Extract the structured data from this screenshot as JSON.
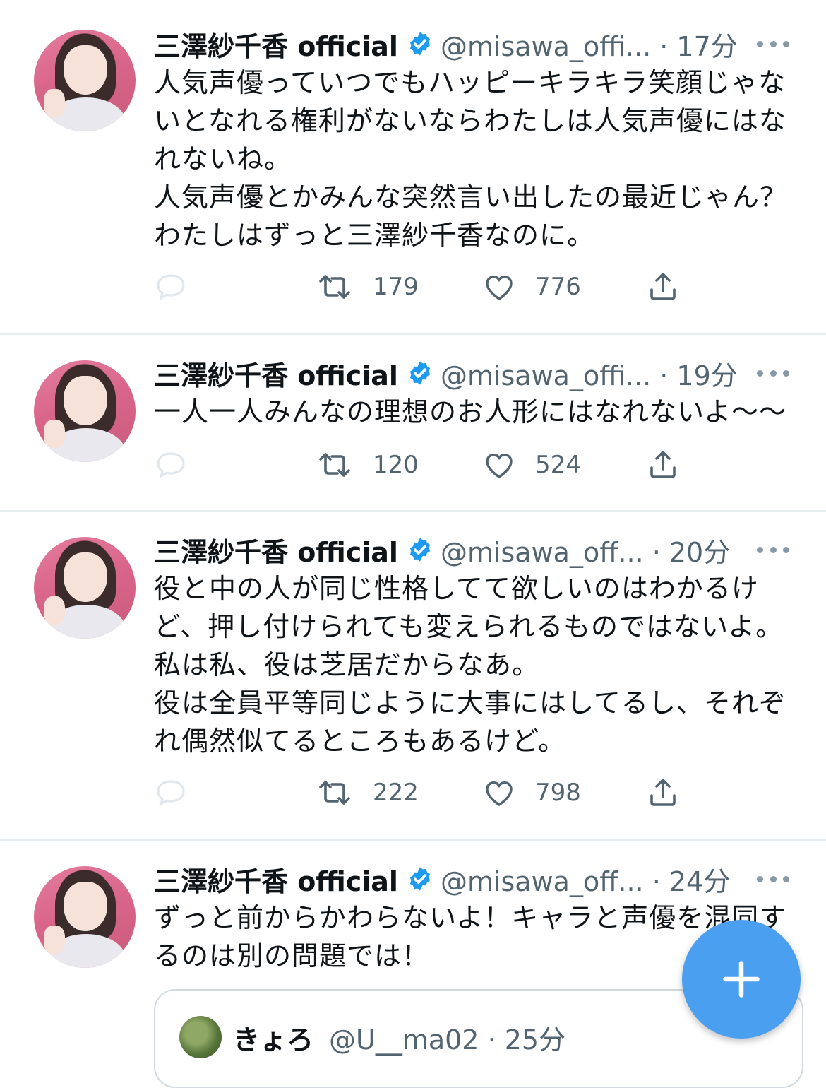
{
  "tweets": [
    {
      "name": "三澤紗千香 official",
      "handle": "@misawa_offi... · 17分",
      "lines": [
        "人気声優っていつでもハッピーキラキラ笑顔じゃな",
        "いとなれる権利がないならわたしは人気声優にはな",
        "れないね。",
        "人気声優とかみんな突然言い出したの最近じゃん？",
        "わたしはずっと三澤紗千香なのに。"
      ],
      "retweets": "179",
      "likes": "776"
    },
    {
      "name": "三澤紗千香 official",
      "handle": "@misawa_offi... · 19分",
      "lines": [
        "一人一人みんなの理想のお人形にはなれないよ〜〜"
      ],
      "retweets": "120",
      "likes": "524"
    },
    {
      "name": "三澤紗千香 official",
      "handle": "@misawa_off... · 20分",
      "lines": [
        "役と中の人が同じ性格してて欲しいのはわかるけ",
        "ど、押し付けられても変えられるものではないよ。",
        "私は私、役は芝居だからなあ。",
        "役は全員平等同じように大事にはしてるし、それぞ",
        "れ偶然似てるところもあるけど。"
      ],
      "retweets": "222",
      "likes": "798"
    },
    {
      "name": "三澤紗千香 official",
      "handle": "@misawa_off... · 24分",
      "lines": [
        "ずっと前からかわらないよ！キャラと声優を混同す",
        "るのは別の問題では！"
      ],
      "quote": {
        "name": "きょろ",
        "handle": "@U__ma02 · 25分"
      }
    }
  ],
  "colors": {
    "accent": "#1d9bf0",
    "fab": "#4a9ff0",
    "muted": "#536471",
    "avatar_bg": "#e0708f"
  },
  "icons": [
    "reply-icon",
    "retweet-icon",
    "like-icon",
    "share-icon",
    "verified-icon",
    "more-icon",
    "compose-icon"
  ]
}
